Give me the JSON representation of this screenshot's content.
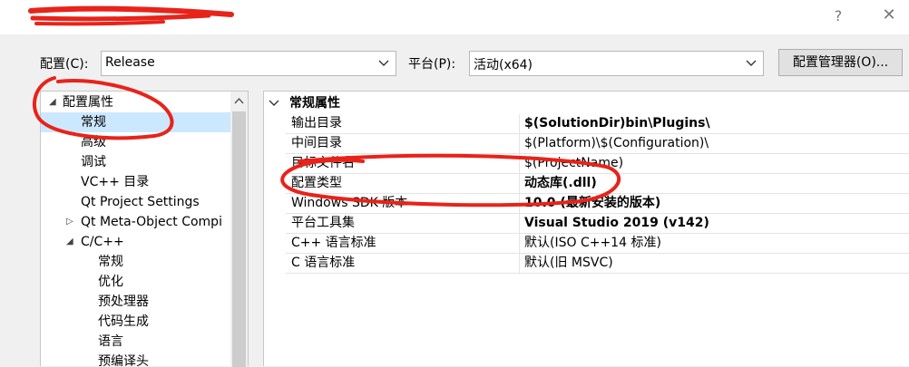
{
  "window": {
    "help_glyph": "?",
    "close_glyph": "✕"
  },
  "toolbar": {
    "config_label": "配置(C):",
    "config_value": "Release",
    "platform_label": "平台(P):",
    "platform_value": "活动(x64)",
    "manager_button": "配置管理器(O)..."
  },
  "tree": {
    "items": [
      {
        "label": "配置属性",
        "expander": "◢"
      },
      {
        "label": "常规"
      },
      {
        "label": "高级"
      },
      {
        "label": "调试"
      },
      {
        "label": "VC++ 目录"
      },
      {
        "label": "Qt Project Settings"
      },
      {
        "label": "Qt Meta-Object Compi",
        "expander": "▷"
      },
      {
        "label": "C/C++",
        "expander": "◢"
      },
      {
        "label": "常规"
      },
      {
        "label": "优化"
      },
      {
        "label": "预处理器"
      },
      {
        "label": "代码生成"
      },
      {
        "label": "语言"
      },
      {
        "label": "预编译头"
      }
    ],
    "selected_index": 1
  },
  "properties": {
    "section_title": "常规属性",
    "rows": [
      {
        "name": "输出目录",
        "value": "$(SolutionDir)bin\\Plugins\\"
      },
      {
        "name": "中间目录",
        "value": "$(Platform)\\$(Configuration)\\"
      },
      {
        "name": "目标文件名",
        "value": "$(ProjectName)"
      },
      {
        "name": "配置类型",
        "value": "动态库(.dll)"
      },
      {
        "name": "Windows SDK 版本",
        "value": "10.0 (最新安装的版本)"
      },
      {
        "name": "平台工具集",
        "value": "Visual Studio 2019 (v142)"
      },
      {
        "name": "C++ 语言标准",
        "value": "默认(ISO C++14 标准)"
      },
      {
        "name": "C 语言标准",
        "value": "默认(旧 MSVC)"
      }
    ]
  },
  "colors": {
    "annotation_red": "#e8231a",
    "selection_bg": "#cce8ff",
    "dialog_bg": "#f0f0f0"
  }
}
